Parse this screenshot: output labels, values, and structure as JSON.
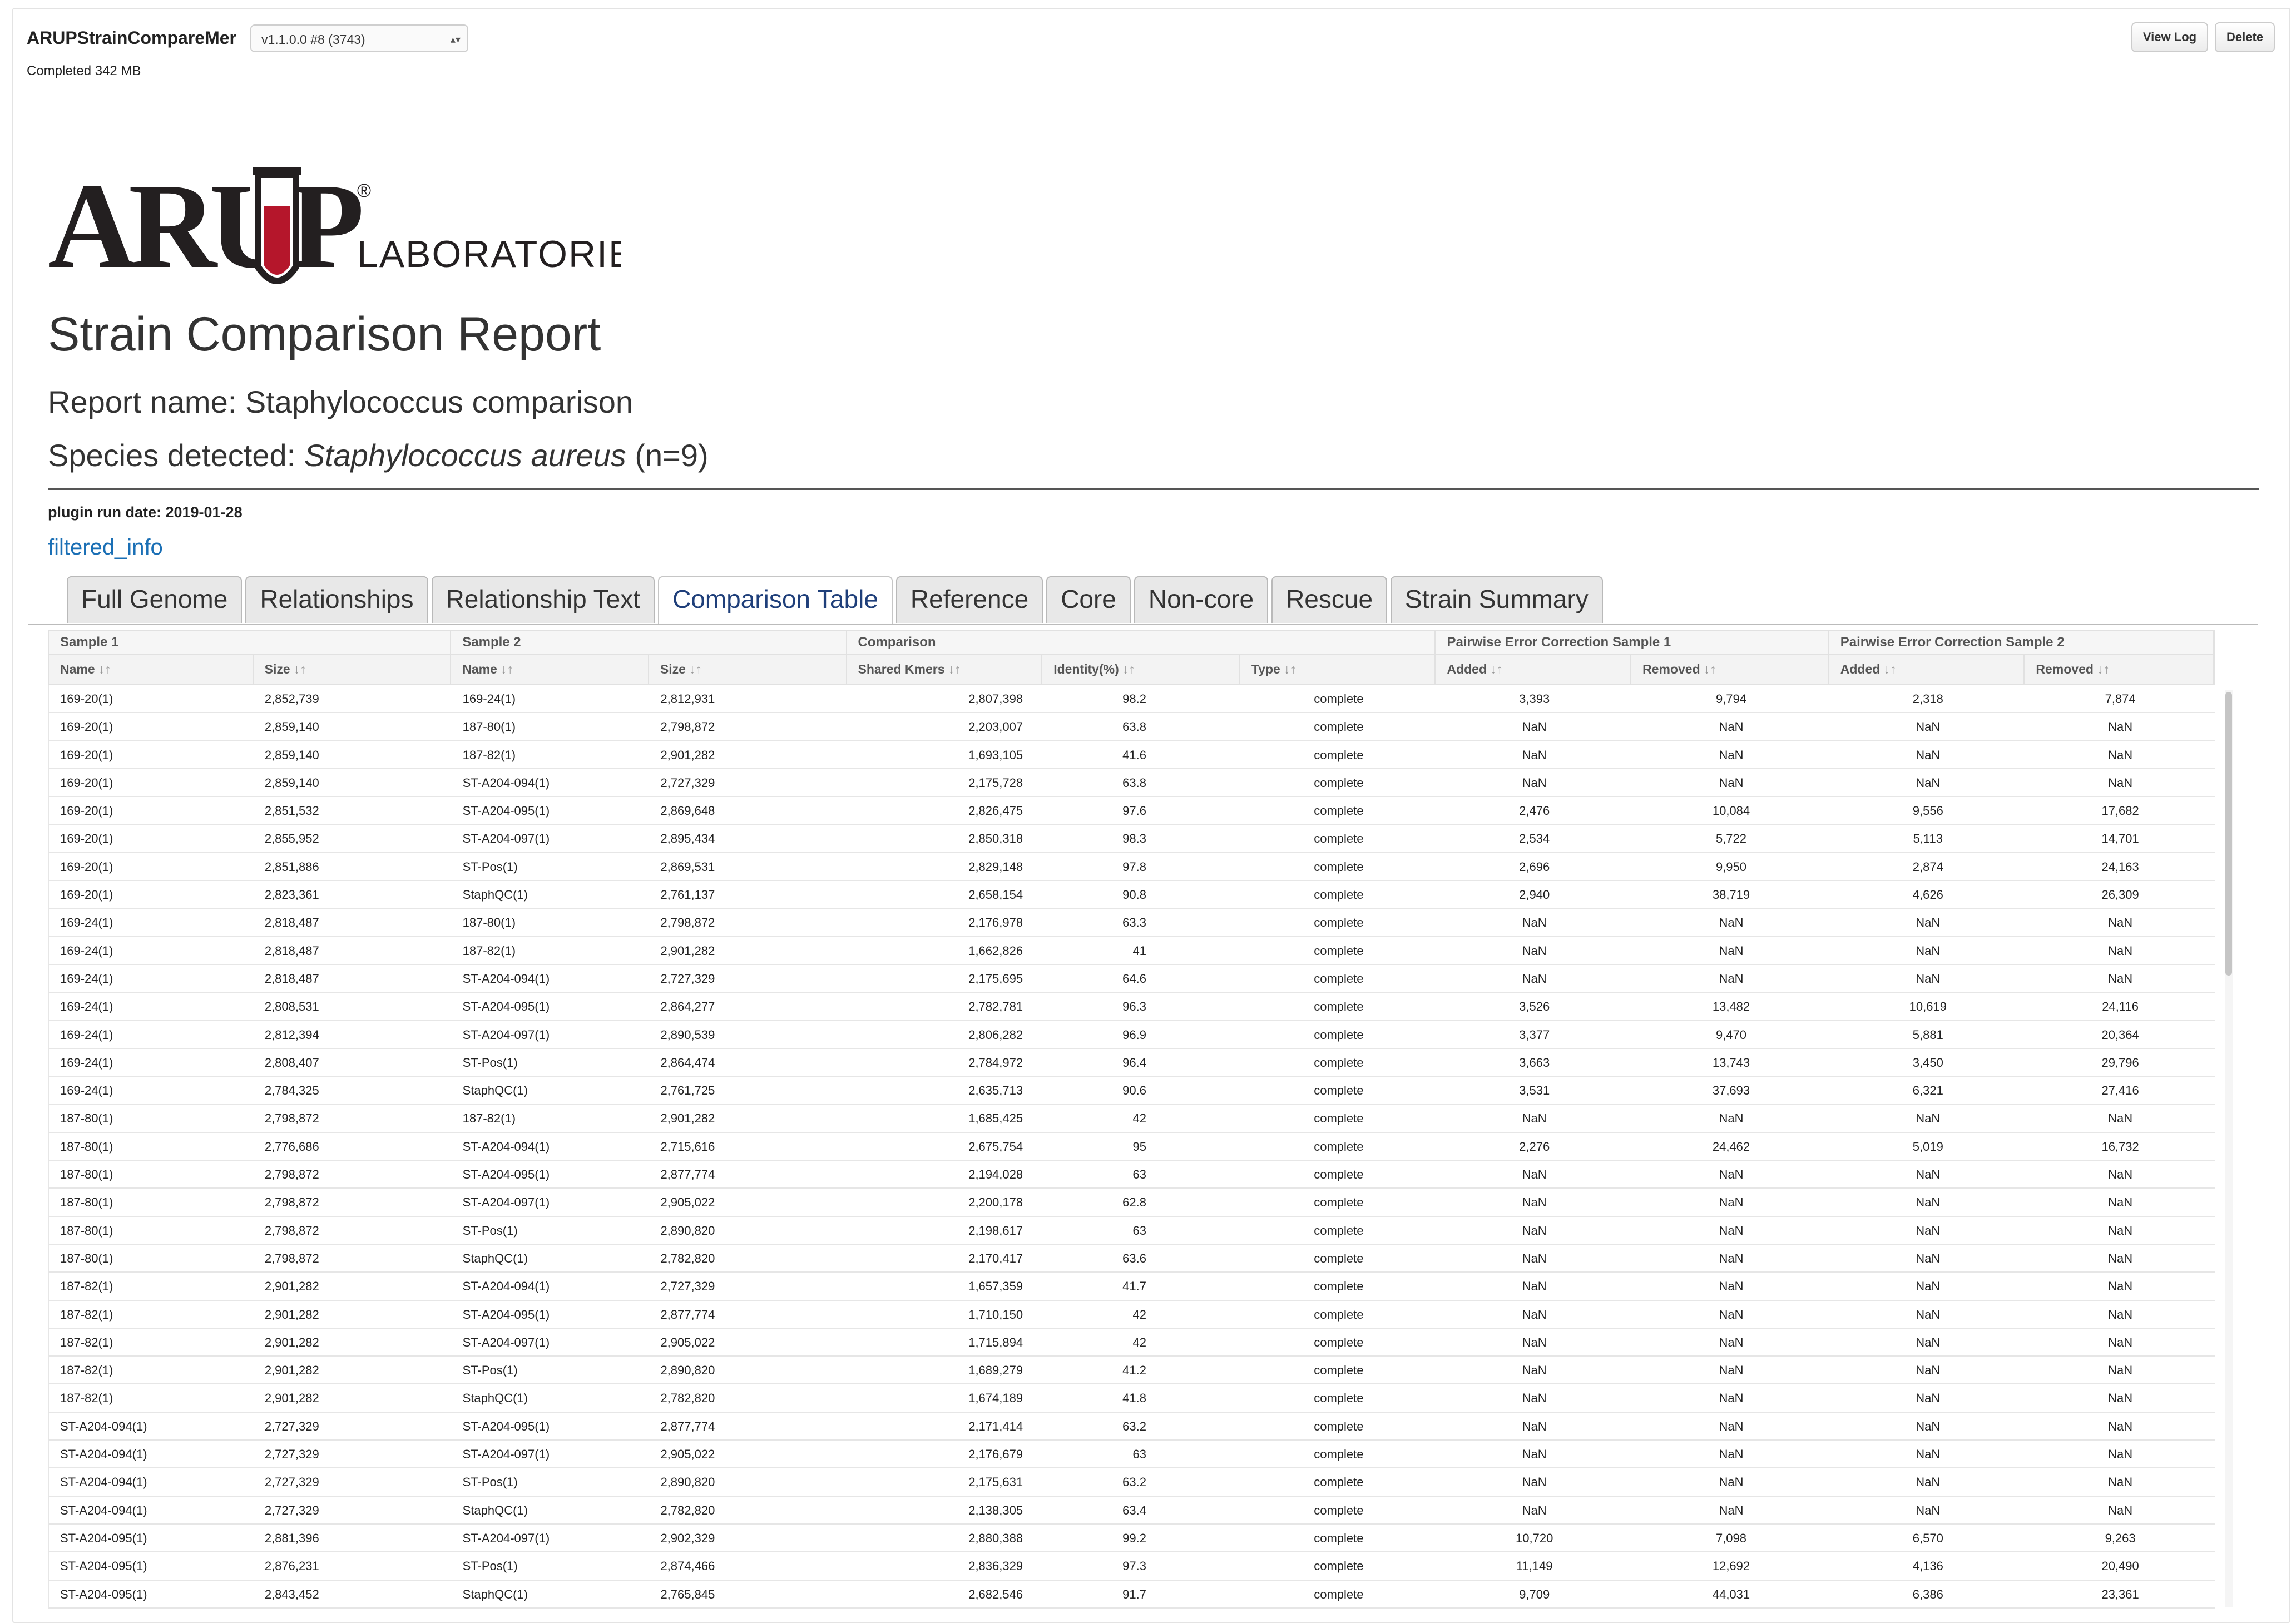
{
  "header": {
    "app_title": "ARUPStrainCompareMer",
    "version_selected": "v1.1.0.0 #8 (3743)",
    "status": "Completed 342 MB",
    "view_log_label": "View Log",
    "delete_label": "Delete"
  },
  "logo": {
    "text": "ARUP",
    "sub_text": "LABORATORIES",
    "registered": "®",
    "tube_color": "#b5162b"
  },
  "report": {
    "title": "Strain Comparison Report",
    "name": "Report name: Staphylococcus comparison",
    "species_prefix": "Species detected: ",
    "species_name": "Staphylococcus aureus",
    "species_suffix": " (n=9)",
    "run_date": "plugin run date: 2019-01-28",
    "filtered_link": "filtered_info"
  },
  "tabs": [
    {
      "label": "Full Genome",
      "active": false
    },
    {
      "label": "Relationships",
      "active": false
    },
    {
      "label": "Relationship Text",
      "active": false
    },
    {
      "label": "Comparison Table",
      "active": true
    },
    {
      "label": "Reference",
      "active": false
    },
    {
      "label": "Core",
      "active": false
    },
    {
      "label": "Non-core",
      "active": false
    },
    {
      "label": "Rescue",
      "active": false
    },
    {
      "label": "Strain Summary",
      "active": false
    }
  ],
  "table": {
    "groups": [
      "Sample 1",
      "Sample 2",
      "Comparison",
      "Pairwise Error Correction Sample 1",
      "Pairwise Error Correction Sample 2"
    ],
    "columns": [
      "Name",
      "Size",
      "Name",
      "Size",
      "Shared Kmers",
      "Identity(%)",
      "Type",
      "Added",
      "Removed",
      "Added",
      "Removed"
    ],
    "sort_glyph": "↓↑",
    "rows": [
      [
        "169-20(1)",
        "2,852,739",
        "169-24(1)",
        "2,812,931",
        "2,807,398",
        "98.2",
        "complete",
        "3,393",
        "9,794",
        "2,318",
        "7,874"
      ],
      [
        "169-20(1)",
        "2,859,140",
        "187-80(1)",
        "2,798,872",
        "2,203,007",
        "63.8",
        "complete",
        "NaN",
        "NaN",
        "NaN",
        "NaN"
      ],
      [
        "169-20(1)",
        "2,859,140",
        "187-82(1)",
        "2,901,282",
        "1,693,105",
        "41.6",
        "complete",
        "NaN",
        "NaN",
        "NaN",
        "NaN"
      ],
      [
        "169-20(1)",
        "2,859,140",
        "ST-A204-094(1)",
        "2,727,329",
        "2,175,728",
        "63.8",
        "complete",
        "NaN",
        "NaN",
        "NaN",
        "NaN"
      ],
      [
        "169-20(1)",
        "2,851,532",
        "ST-A204-095(1)",
        "2,869,648",
        "2,826,475",
        "97.6",
        "complete",
        "2,476",
        "10,084",
        "9,556",
        "17,682"
      ],
      [
        "169-20(1)",
        "2,855,952",
        "ST-A204-097(1)",
        "2,895,434",
        "2,850,318",
        "98.3",
        "complete",
        "2,534",
        "5,722",
        "5,113",
        "14,701"
      ],
      [
        "169-20(1)",
        "2,851,886",
        "ST-Pos(1)",
        "2,869,531",
        "2,829,148",
        "97.8",
        "complete",
        "2,696",
        "9,950",
        "2,874",
        "24,163"
      ],
      [
        "169-20(1)",
        "2,823,361",
        "StaphQC(1)",
        "2,761,137",
        "2,658,154",
        "90.8",
        "complete",
        "2,940",
        "38,719",
        "4,626",
        "26,309"
      ],
      [
        "169-24(1)",
        "2,818,487",
        "187-80(1)",
        "2,798,872",
        "2,176,978",
        "63.3",
        "complete",
        "NaN",
        "NaN",
        "NaN",
        "NaN"
      ],
      [
        "169-24(1)",
        "2,818,487",
        "187-82(1)",
        "2,901,282",
        "1,662,826",
        "41",
        "complete",
        "NaN",
        "NaN",
        "NaN",
        "NaN"
      ],
      [
        "169-24(1)",
        "2,818,487",
        "ST-A204-094(1)",
        "2,727,329",
        "2,175,695",
        "64.6",
        "complete",
        "NaN",
        "NaN",
        "NaN",
        "NaN"
      ],
      [
        "169-24(1)",
        "2,808,531",
        "ST-A204-095(1)",
        "2,864,277",
        "2,782,781",
        "96.3",
        "complete",
        "3,526",
        "13,482",
        "10,619",
        "24,116"
      ],
      [
        "169-24(1)",
        "2,812,394",
        "ST-A204-097(1)",
        "2,890,539",
        "2,806,282",
        "96.9",
        "complete",
        "3,377",
        "9,470",
        "5,881",
        "20,364"
      ],
      [
        "169-24(1)",
        "2,808,407",
        "ST-Pos(1)",
        "2,864,474",
        "2,784,972",
        "96.4",
        "complete",
        "3,663",
        "13,743",
        "3,450",
        "29,796"
      ],
      [
        "169-24(1)",
        "2,784,325",
        "StaphQC(1)",
        "2,761,725",
        "2,635,713",
        "90.6",
        "complete",
        "3,531",
        "37,693",
        "6,321",
        "27,416"
      ],
      [
        "187-80(1)",
        "2,798,872",
        "187-82(1)",
        "2,901,282",
        "1,685,425",
        "42",
        "complete",
        "NaN",
        "NaN",
        "NaN",
        "NaN"
      ],
      [
        "187-80(1)",
        "2,776,686",
        "ST-A204-094(1)",
        "2,715,616",
        "2,675,754",
        "95",
        "complete",
        "2,276",
        "24,462",
        "5,019",
        "16,732"
      ],
      [
        "187-80(1)",
        "2,798,872",
        "ST-A204-095(1)",
        "2,877,774",
        "2,194,028",
        "63",
        "complete",
        "NaN",
        "NaN",
        "NaN",
        "NaN"
      ],
      [
        "187-80(1)",
        "2,798,872",
        "ST-A204-097(1)",
        "2,905,022",
        "2,200,178",
        "62.8",
        "complete",
        "NaN",
        "NaN",
        "NaN",
        "NaN"
      ],
      [
        "187-80(1)",
        "2,798,872",
        "ST-Pos(1)",
        "2,890,820",
        "2,198,617",
        "63",
        "complete",
        "NaN",
        "NaN",
        "NaN",
        "NaN"
      ],
      [
        "187-80(1)",
        "2,798,872",
        "StaphQC(1)",
        "2,782,820",
        "2,170,417",
        "63.6",
        "complete",
        "NaN",
        "NaN",
        "NaN",
        "NaN"
      ],
      [
        "187-82(1)",
        "2,901,282",
        "ST-A204-094(1)",
        "2,727,329",
        "1,657,359",
        "41.7",
        "complete",
        "NaN",
        "NaN",
        "NaN",
        "NaN"
      ],
      [
        "187-82(1)",
        "2,901,282",
        "ST-A204-095(1)",
        "2,877,774",
        "1,710,150",
        "42",
        "complete",
        "NaN",
        "NaN",
        "NaN",
        "NaN"
      ],
      [
        "187-82(1)",
        "2,901,282",
        "ST-A204-097(1)",
        "2,905,022",
        "1,715,894",
        "42",
        "complete",
        "NaN",
        "NaN",
        "NaN",
        "NaN"
      ],
      [
        "187-82(1)",
        "2,901,282",
        "ST-Pos(1)",
        "2,890,820",
        "1,689,279",
        "41.2",
        "complete",
        "NaN",
        "NaN",
        "NaN",
        "NaN"
      ],
      [
        "187-82(1)",
        "2,901,282",
        "StaphQC(1)",
        "2,782,820",
        "1,674,189",
        "41.8",
        "complete",
        "NaN",
        "NaN",
        "NaN",
        "NaN"
      ],
      [
        "ST-A204-094(1)",
        "2,727,329",
        "ST-A204-095(1)",
        "2,877,774",
        "2,171,414",
        "63.2",
        "complete",
        "NaN",
        "NaN",
        "NaN",
        "NaN"
      ],
      [
        "ST-A204-094(1)",
        "2,727,329",
        "ST-A204-097(1)",
        "2,905,022",
        "2,176,679",
        "63",
        "complete",
        "NaN",
        "NaN",
        "NaN",
        "NaN"
      ],
      [
        "ST-A204-094(1)",
        "2,727,329",
        "ST-Pos(1)",
        "2,890,820",
        "2,175,631",
        "63.2",
        "complete",
        "NaN",
        "NaN",
        "NaN",
        "NaN"
      ],
      [
        "ST-A204-094(1)",
        "2,727,329",
        "StaphQC(1)",
        "2,782,820",
        "2,138,305",
        "63.4",
        "complete",
        "NaN",
        "NaN",
        "NaN",
        "NaN"
      ],
      [
        "ST-A204-095(1)",
        "2,881,396",
        "ST-A204-097(1)",
        "2,902,329",
        "2,880,388",
        "99.2",
        "complete",
        "10,720",
        "7,098",
        "6,570",
        "9,263"
      ],
      [
        "ST-A204-095(1)",
        "2,876,231",
        "ST-Pos(1)",
        "2,874,466",
        "2,836,329",
        "97.3",
        "complete",
        "11,149",
        "12,692",
        "4,136",
        "20,490"
      ],
      [
        "ST-A204-095(1)",
        "2,843,452",
        "StaphQC(1)",
        "2,765,845",
        "2,682,546",
        "91.7",
        "complete",
        "9,709",
        "44,031",
        "6,386",
        "23,361"
      ]
    ]
  }
}
